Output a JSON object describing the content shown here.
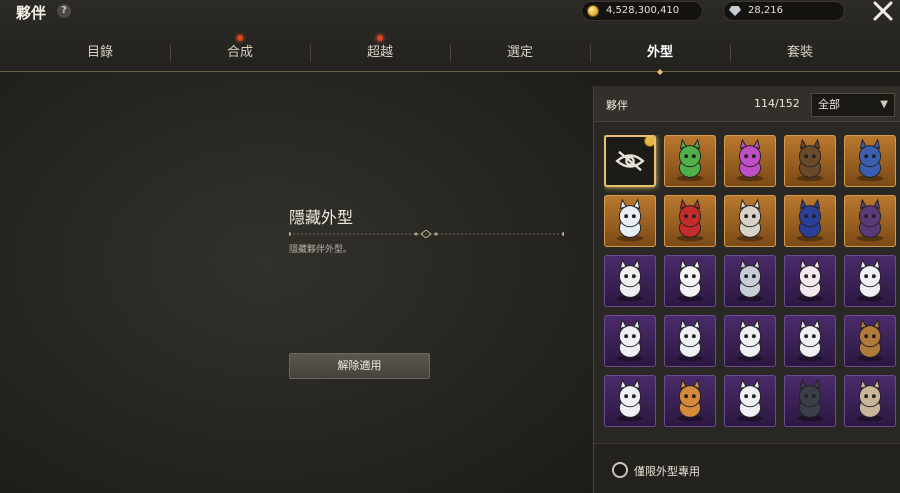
{
  "header": {
    "title": "夥伴",
    "help_icon": "question-mark-icon"
  },
  "currency": {
    "gold": "4,528,300,410",
    "gem": "28,216"
  },
  "tabs": [
    {
      "label": "目錄",
      "notify": false
    },
    {
      "label": "合成",
      "notify": true
    },
    {
      "label": "超越",
      "notify": true
    },
    {
      "label": "選定",
      "notify": false
    },
    {
      "label": "外型",
      "notify": false,
      "active": true
    },
    {
      "label": "套裝",
      "notify": false
    }
  ],
  "preview": {
    "title": "隱藏外型",
    "description": "隱藏夥伴外型。",
    "remove_button": "解除適用"
  },
  "panel": {
    "label": "夥伴",
    "count": "114/152",
    "filter_selected": "全部",
    "footer_option": "僅限外型專用"
  },
  "grid": {
    "items": [
      {
        "kind": "hide-appearance-icon",
        "frame": "selected",
        "equipped": true
      },
      {
        "kind": "green-dragon-pet",
        "frame": "orange"
      },
      {
        "kind": "jester-pet",
        "frame": "orange"
      },
      {
        "kind": "bird-pet",
        "frame": "orange"
      },
      {
        "kind": "blue-dragon-pet",
        "frame": "orange"
      },
      {
        "kind": "white-tiger-pet",
        "frame": "orange"
      },
      {
        "kind": "red-dragon-pet",
        "frame": "orange"
      },
      {
        "kind": "white-cat-pet",
        "frame": "orange"
      },
      {
        "kind": "blue-bird-pet",
        "frame": "orange"
      },
      {
        "kind": "purple-beast-pet",
        "frame": "orange"
      },
      {
        "kind": "rabbit-pet",
        "frame": "purple"
      },
      {
        "kind": "panda-rabbit-pet",
        "frame": "purple"
      },
      {
        "kind": "mouse-pet",
        "frame": "purple"
      },
      {
        "kind": "pink-rabbit-pet",
        "frame": "purple"
      },
      {
        "kind": "robot-pet",
        "frame": "purple"
      },
      {
        "kind": "robot-pet",
        "frame": "purple"
      },
      {
        "kind": "robot-pet",
        "frame": "purple"
      },
      {
        "kind": "robot-pet",
        "frame": "purple"
      },
      {
        "kind": "robot-pet",
        "frame": "purple"
      },
      {
        "kind": "monkey-pet",
        "frame": "purple"
      },
      {
        "kind": "robot-pet",
        "frame": "purple"
      },
      {
        "kind": "lion-pet",
        "frame": "purple"
      },
      {
        "kind": "robot-pet",
        "frame": "purple"
      },
      {
        "kind": "dark-beast-pet",
        "frame": "purple"
      },
      {
        "kind": "otter-pet",
        "frame": "purple"
      }
    ]
  },
  "colors": {
    "accent_gold": "#e6c36a",
    "notify_red": "#e0421d",
    "frame_orange": "#b9782e",
    "frame_purple": "#4b2b6b"
  }
}
